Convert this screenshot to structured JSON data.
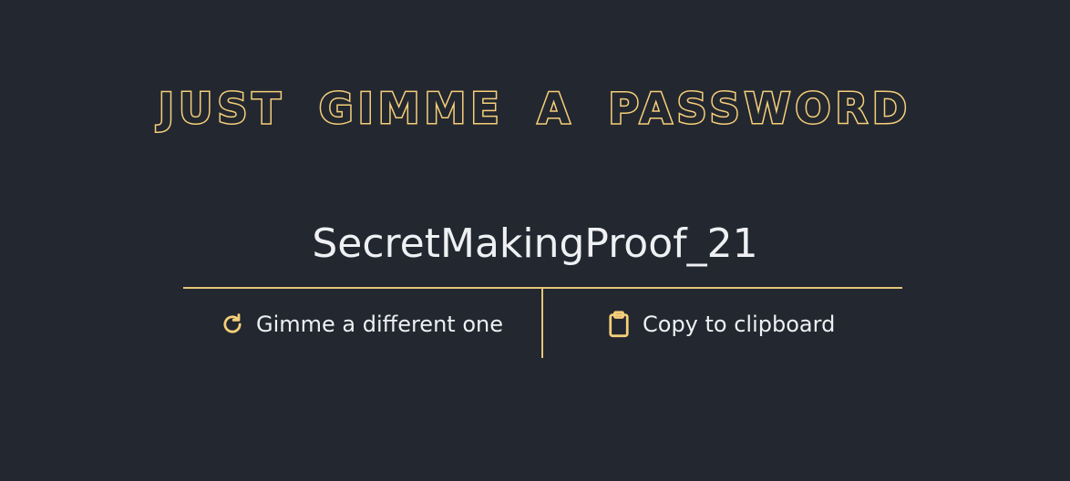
{
  "header": {
    "title": "JUST GIMME A PASSWORD"
  },
  "password": {
    "value": "SecretMakingProof_21"
  },
  "actions": {
    "regenerate_label": "Gimme a different one",
    "regenerate_icon": "refresh-icon",
    "copy_label": "Copy to clipboard",
    "copy_icon": "clipboard-icon"
  },
  "colors": {
    "background": "#23272f",
    "accent": "#f5cf7a",
    "text": "#eef0f3"
  }
}
